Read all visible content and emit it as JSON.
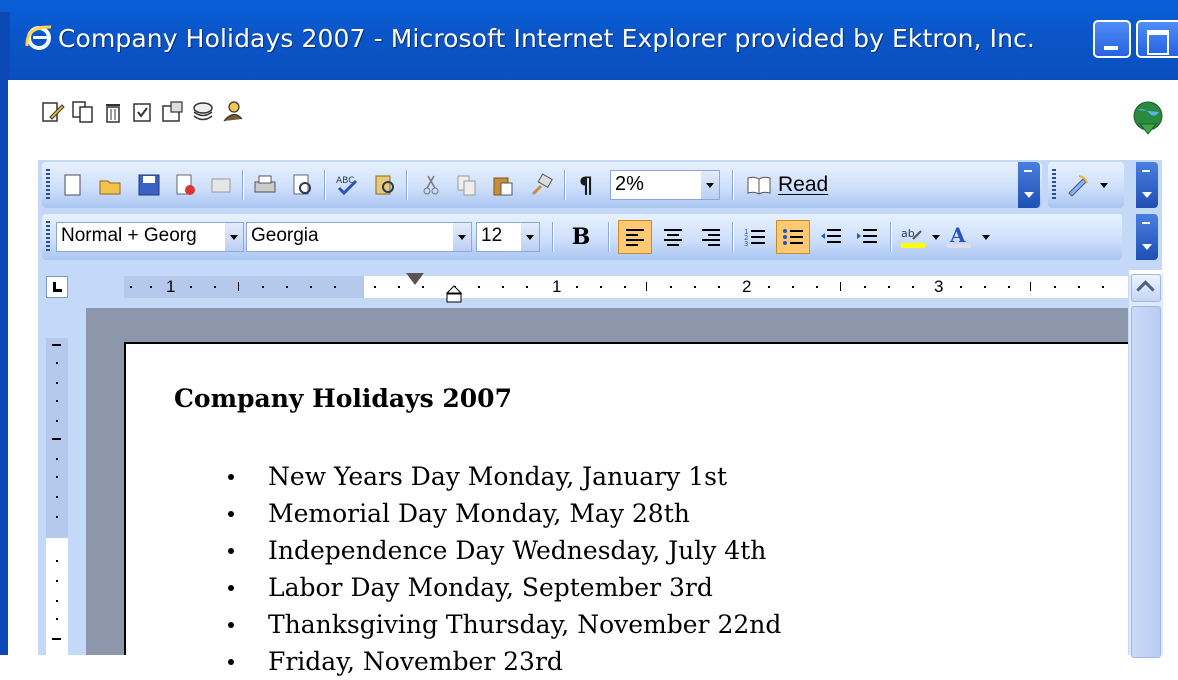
{
  "window": {
    "title": "Company Holidays 2007 - Microsoft Internet Explorer provided by Ektron, Inc."
  },
  "toolbar": {
    "zoom": "2%",
    "read_label": "Read",
    "style": "Normal + Georg",
    "font": "Georgia",
    "size": "12",
    "bold_label": "B"
  },
  "ruler": {
    "numbers": [
      "1",
      "1",
      "2",
      "3"
    ]
  },
  "document": {
    "title": "Company Holidays 2007",
    "items": [
      "New Years Day Monday, January 1st",
      "Memorial Day Monday, May 28th",
      "Independence Day Wednesday, July 4th",
      "Labor Day Monday, September 3rd",
      "Thanksgiving Thursday, November 22nd",
      "Friday, November 23rd"
    ]
  },
  "colors": {
    "titlebar": "#0a55c8",
    "toolbar": "#c4d9f7",
    "active_button": "#ffc873",
    "doc_background": "#8c97ac"
  }
}
